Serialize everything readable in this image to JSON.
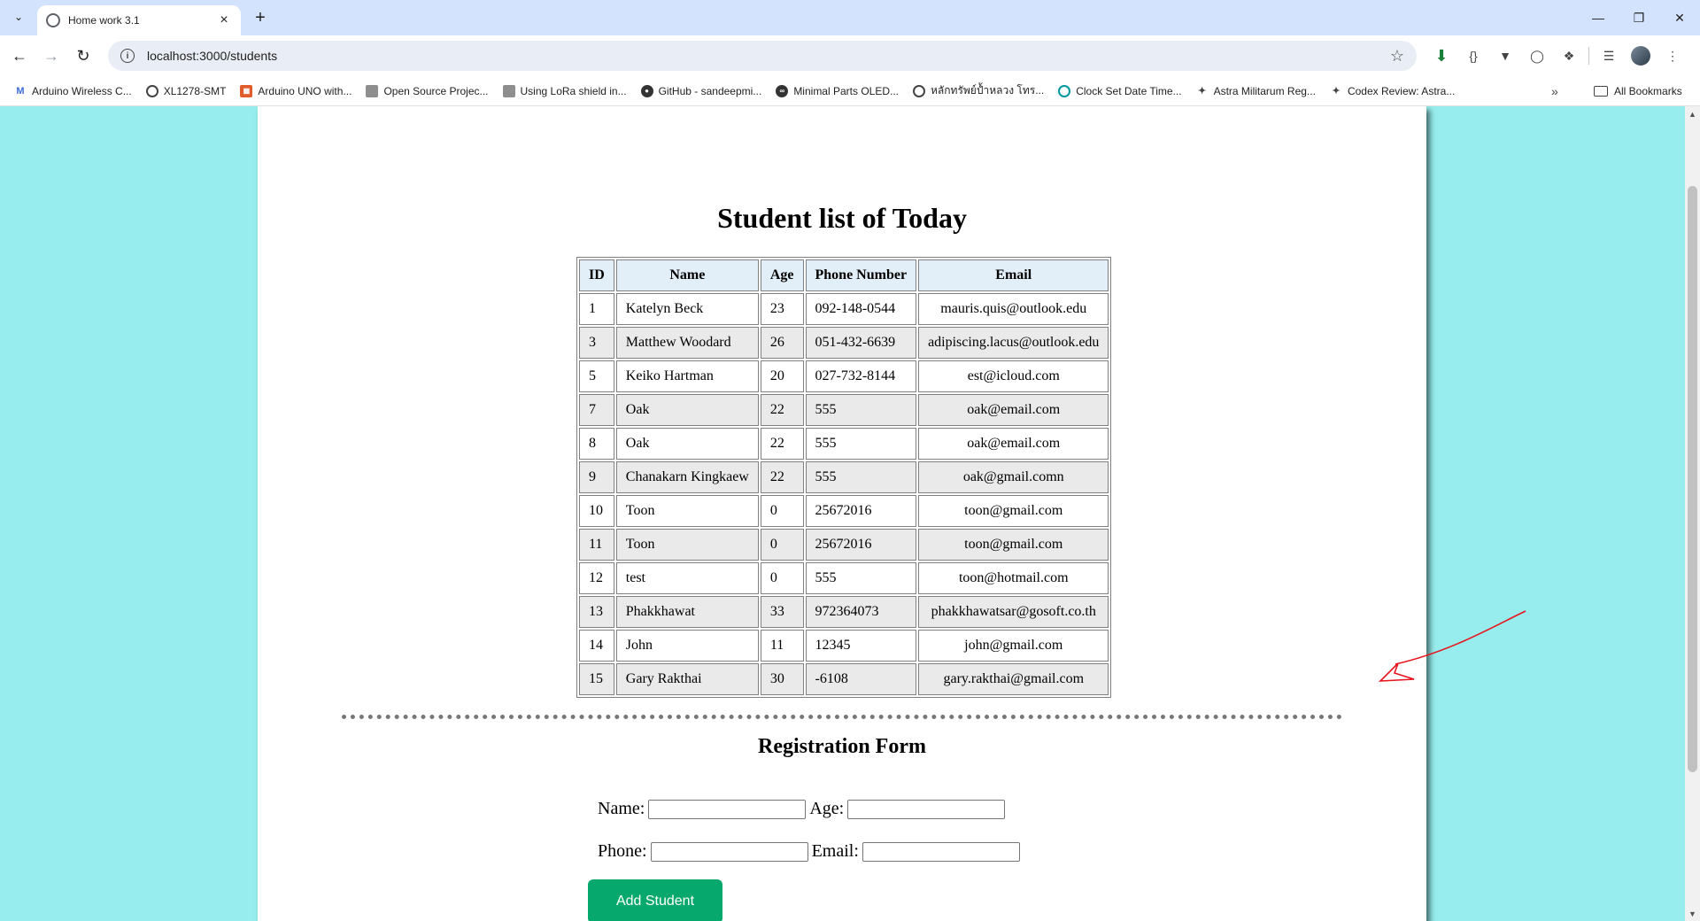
{
  "browser": {
    "tab_title": "Home work 3.1",
    "url": "localhost:3000/students",
    "new_tab_symbol": "+",
    "bookmarks": [
      {
        "label": "Arduino Wireless C...",
        "icon": "gmail-icon"
      },
      {
        "label": "XL1278-SMT",
        "icon": "globe-icon"
      },
      {
        "label": "Arduino UNO with...",
        "icon": "site-icon"
      },
      {
        "label": "Open Source Projec...",
        "icon": "grid-icon"
      },
      {
        "label": "Using LoRa shield in...",
        "icon": "grid-icon"
      },
      {
        "label": "GitHub - sandeepmi...",
        "icon": "github-icon"
      },
      {
        "label": "Minimal Parts OLED...",
        "icon": "site-icon"
      },
      {
        "label": "หลักทรัพย์ป้ำหลวง โทร...",
        "icon": "globe-icon"
      },
      {
        "label": "Clock Set Date Time...",
        "icon": "arduino-icon"
      },
      {
        "label": "Astra Militarum Reg...",
        "icon": "astra-icon"
      },
      {
        "label": "Codex Review: Astra...",
        "icon": "astra-icon"
      }
    ],
    "all_bookmarks_label": "All Bookmarks"
  },
  "page": {
    "title": "Student list of Today",
    "table": {
      "headers": [
        "ID",
        "Name",
        "Age",
        "Phone Number",
        "Email"
      ],
      "rows": [
        [
          "1",
          "Katelyn Beck",
          "23",
          "092-148-0544",
          "mauris.quis@outlook.edu"
        ],
        [
          "3",
          "Matthew Woodard",
          "26",
          "051-432-6639",
          "adipiscing.lacus@outlook.edu"
        ],
        [
          "5",
          "Keiko Hartman",
          "20",
          "027-732-8144",
          "est@icloud.com"
        ],
        [
          "7",
          "Oak",
          "22",
          "555",
          "oak@email.com"
        ],
        [
          "8",
          "Oak",
          "22",
          "555",
          "oak@email.com"
        ],
        [
          "9",
          "Chanakarn Kingkaew",
          "22",
          "555",
          "oak@gmail.comn"
        ],
        [
          "10",
          "Toon",
          "0",
          "25672016",
          "toon@gmail.com"
        ],
        [
          "11",
          "Toon",
          "0",
          "25672016",
          "toon@gmail.com"
        ],
        [
          "12",
          "test",
          "0",
          "555",
          "toon@hotmail.com"
        ],
        [
          "13",
          "Phakkhawat",
          "33",
          "972364073",
          "phakkhawatsar@gosoft.co.th"
        ],
        [
          "14",
          "John",
          "11",
          "12345",
          "john@gmail.com"
        ],
        [
          "15",
          "Gary Rakthai",
          "30",
          "-6108",
          "gary.rakthai@gmail.com"
        ]
      ]
    },
    "form": {
      "title": "Registration Form",
      "name_label": "Name:",
      "age_label": "Age:",
      "phone_label": "Phone:",
      "email_label": "Email:",
      "name_value": "",
      "age_value": "",
      "phone_value": "",
      "email_value": "",
      "submit_label": "Add Student"
    }
  },
  "colors": {
    "page_background": "#97eded",
    "header_cell": "#e2eef8",
    "button": "#07a86d",
    "annotation": "#e8141c"
  }
}
